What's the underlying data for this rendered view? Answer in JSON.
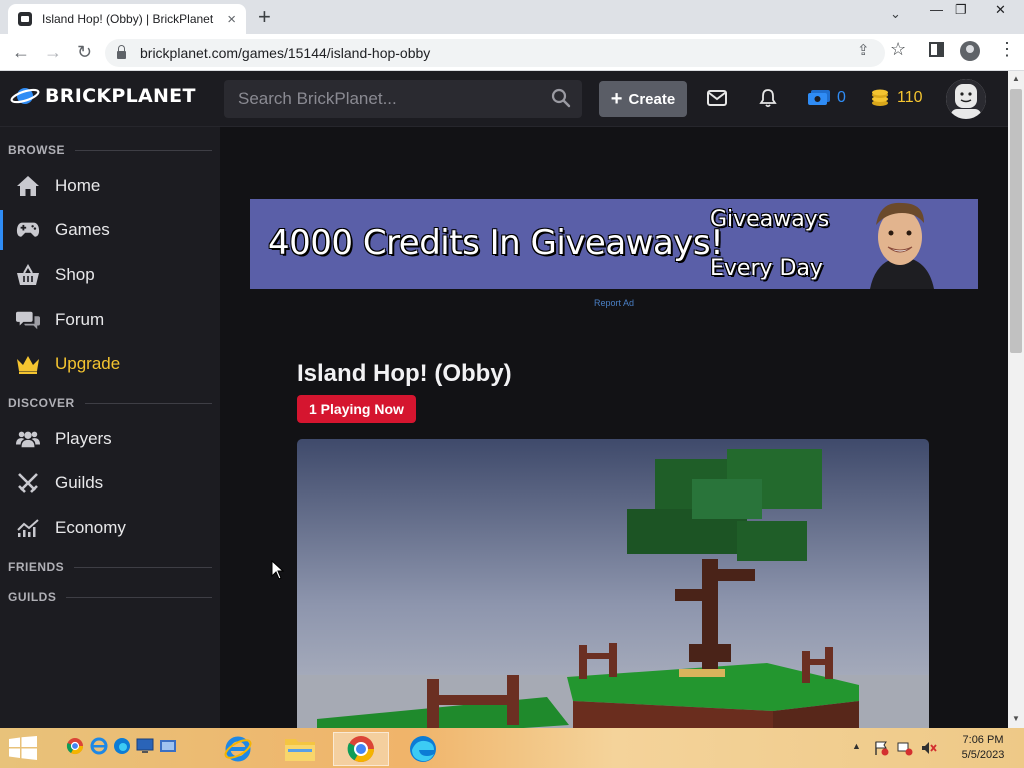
{
  "browser": {
    "tab_title": "Island Hop! (Obby) | BrickPlanet",
    "tab_close": "×",
    "new_tab": "+",
    "url": "brickplanet.com/games/15144/island-hop-obby",
    "back": "←",
    "forward": "→",
    "reload": "↻",
    "share_icon": "⇪",
    "bookmark_icon": "☆",
    "menu_icon": "⋮",
    "tabs_menu": "⌄",
    "minimize": "—",
    "restore": "❐",
    "close": "✕"
  },
  "header": {
    "logo_text": "BRICKPLANET",
    "search_placeholder": "Search BrickPlanet...",
    "create_label": "Create",
    "create_plus": "+",
    "bucks": "0",
    "credits": "110",
    "colors": {
      "bucks": "#2f8cf5",
      "credits": "#f4c430",
      "accent": "#2f8cf5"
    }
  },
  "sidebar": {
    "sections": [
      {
        "label": "BROWSE"
      },
      {
        "label": "DISCOVER"
      },
      {
        "label": "FRIENDS"
      },
      {
        "label": "GUILDS"
      }
    ],
    "items": [
      {
        "label": "Home",
        "icon": "home-icon"
      },
      {
        "label": "Games",
        "icon": "gamepad-icon",
        "active": true
      },
      {
        "label": "Shop",
        "icon": "basket-icon"
      },
      {
        "label": "Forum",
        "icon": "comments-icon"
      },
      {
        "label": "Upgrade",
        "icon": "crown-icon",
        "color": "#f4c430"
      },
      {
        "label": "Players",
        "icon": "users-icon"
      },
      {
        "label": "Guilds",
        "icon": "swords-icon"
      },
      {
        "label": "Economy",
        "icon": "chart-icon"
      }
    ]
  },
  "main": {
    "banner": {
      "title": "4000 Credits In Giveaways!",
      "line1": "Giveaways",
      "line2": "Every Day"
    },
    "report_ad": "Report Ad",
    "game_title": "Island Hop! (Obby)",
    "playing_badge": "1 Playing Now"
  },
  "taskbar": {
    "time": "7:06 PM",
    "date": "5/5/2023"
  }
}
